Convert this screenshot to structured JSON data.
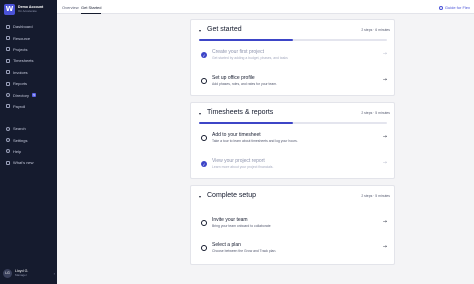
{
  "sidebar": {
    "account": {
      "logo_letter": "W",
      "name": "Demo Account",
      "sub": "On Accelerate"
    },
    "items": [
      {
        "label": "Dashboard",
        "icon": "dashboard-icon"
      },
      {
        "label": "Resource",
        "icon": "resource-icon"
      },
      {
        "label": "Projects",
        "icon": "projects-icon"
      },
      {
        "label": "Timesheets",
        "icon": "timesheets-icon"
      },
      {
        "label": "Invoices",
        "icon": "invoices-icon"
      },
      {
        "label": "Reports",
        "icon": "reports-icon"
      },
      {
        "label": "Directory",
        "icon": "directory-icon",
        "badge": "5"
      },
      {
        "label": "Payroll",
        "icon": "payroll-icon"
      }
    ],
    "bottom_items": [
      {
        "label": "Search",
        "icon": "search-icon"
      },
      {
        "label": "Settings",
        "icon": "gear-icon"
      },
      {
        "label": "Help",
        "icon": "help-icon"
      },
      {
        "label": "What's new",
        "icon": "megaphone-icon"
      }
    ],
    "user": {
      "initials": "LG",
      "name": "Lloyd G.",
      "role": "Manager"
    }
  },
  "topbar": {
    "tabs": [
      {
        "label": "Overview"
      },
      {
        "label": "Get Started"
      }
    ],
    "guide_label": "Guide for Flex"
  },
  "sections": [
    {
      "title": "Get started",
      "meta": "2 steps · 6 minutes",
      "progress": 0.5,
      "steps": [
        {
          "title": "Create your first project",
          "desc": "Get started by adding a budget, phases, and tasks",
          "done": true
        },
        {
          "title": "Set up office profile",
          "desc": "Add phases, roles, and rates for your team.",
          "done": false
        }
      ]
    },
    {
      "title": "Timesheets & reports",
      "meta": "2 steps · 5 minutes",
      "progress": 0.5,
      "steps": [
        {
          "title": "Add to your timesheet",
          "desc": "Take a tour to learn about timesheets and log your hours.",
          "done": false
        },
        {
          "title": "View your project report",
          "desc": "Learn more about your project financials.",
          "done": true
        }
      ]
    },
    {
      "title": "Complete setup",
      "meta": "2 steps · 5 minutes",
      "steps": [
        {
          "title": "Invite your team",
          "desc": "Bring your team onboard to collaborate",
          "done": false
        },
        {
          "title": "Select a plan",
          "desc": "Choose between the Grow and Track plan.",
          "done": false
        }
      ]
    }
  ],
  "colors": {
    "sidebar": "#151b2e",
    "accent": "#3d45c7",
    "background": "#f4f4f6"
  }
}
